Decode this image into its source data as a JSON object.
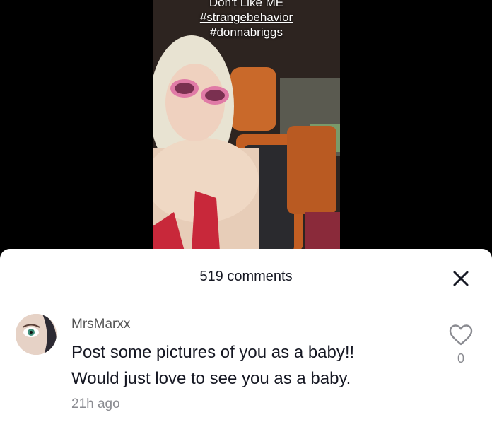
{
  "video": {
    "caption_lines": [
      "Don't Like ME",
      "#strangebehavior",
      "#donnabriggs"
    ]
  },
  "comments_sheet": {
    "title": "519 comments",
    "close_icon": "close-icon"
  },
  "comment": {
    "username": "MrsMarxx",
    "text_line1": "Post some pictures of you as a baby!!",
    "text_line2": "Would just love to see you as a baby.",
    "timestamp": "21h ago",
    "like_count": "0",
    "like_icon": "heart-outline-icon"
  },
  "colors": {
    "sheet_bg": "#ffffff",
    "text_primary": "#161823",
    "text_secondary": "#8a8b91"
  }
}
